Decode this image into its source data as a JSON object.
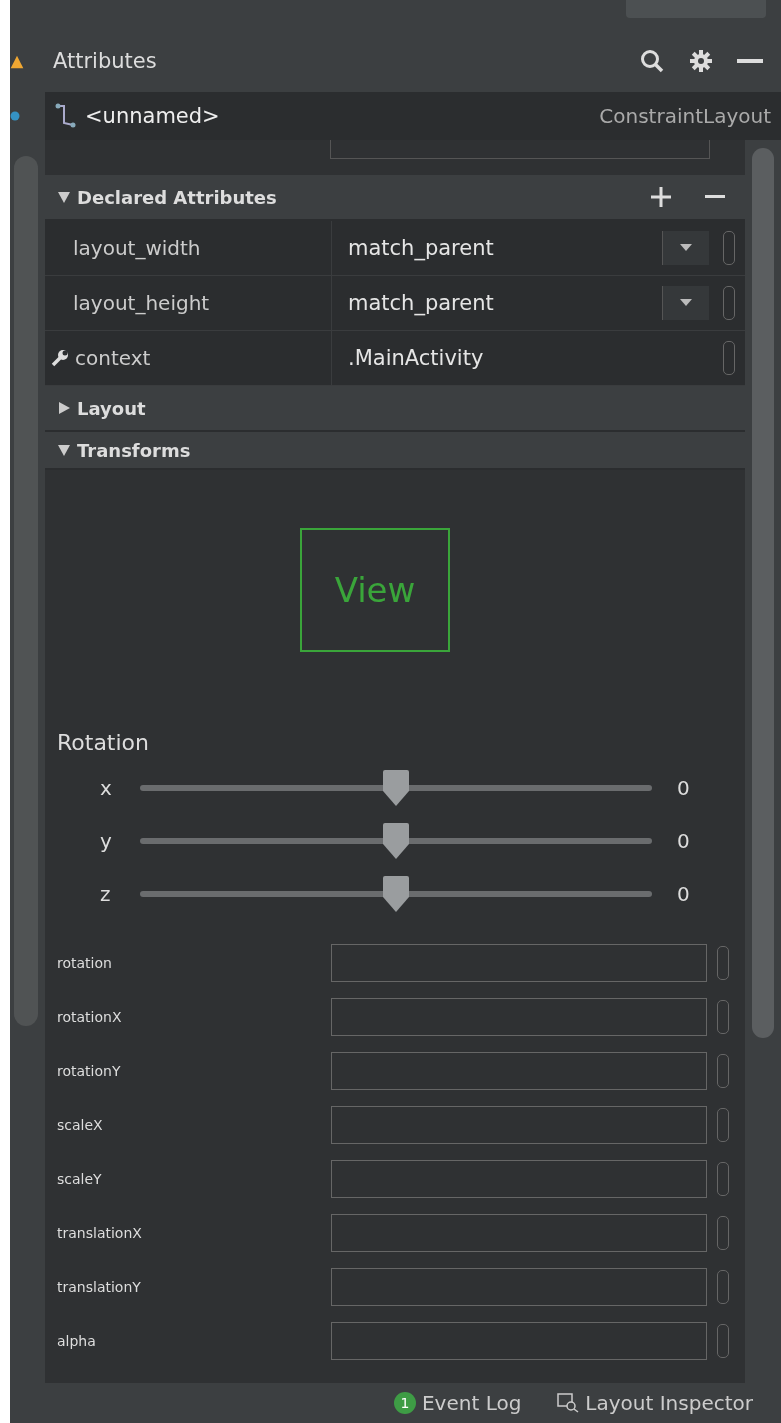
{
  "panel": {
    "title": "Attributes"
  },
  "component": {
    "name": "<unnamed>",
    "type": "ConstraintLayout"
  },
  "sections": [
    {
      "title": "Declared Attributes",
      "expanded": true,
      "kind": "declared"
    },
    {
      "title": "Layout",
      "expanded": false,
      "kind": "empty"
    },
    {
      "title": "Transforms",
      "expanded": true,
      "kind": "transforms"
    }
  ],
  "declared_attributes": [
    {
      "name": "layout_width",
      "value": "match_parent",
      "dropdown": true,
      "wrench": false
    },
    {
      "name": "layout_height",
      "value": "match_parent",
      "dropdown": true,
      "wrench": false
    },
    {
      "name": "context",
      "value": ".MainActivity",
      "dropdown": false,
      "wrench": true
    }
  ],
  "transforms": {
    "preview_label": "View",
    "rotation_title": "Rotation",
    "sliders": [
      {
        "axis": "x",
        "level": 0.5,
        "reading": "0"
      },
      {
        "axis": "y",
        "level": 0.5,
        "reading": "0"
      },
      {
        "axis": "z",
        "level": 0.5,
        "reading": "0"
      }
    ],
    "properties": [
      {
        "name": "rotation"
      },
      {
        "name": "rotationX"
      },
      {
        "name": "rotationY"
      },
      {
        "name": "scaleX"
      },
      {
        "name": "scaleY"
      },
      {
        "name": "translationX"
      },
      {
        "name": "translationY"
      },
      {
        "name": "alpha"
      }
    ]
  },
  "status_bar": {
    "event_count": "1",
    "event_log": "Event Log",
    "layout_inspector": "Layout Inspector"
  }
}
